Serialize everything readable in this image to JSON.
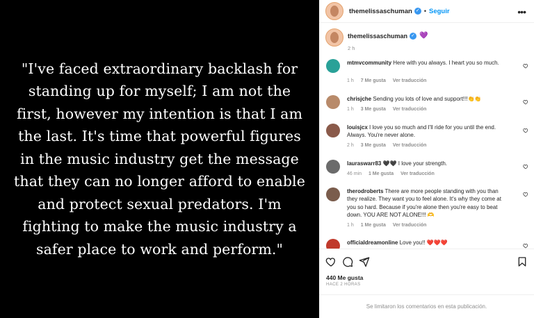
{
  "post": {
    "quote": "\"I've faced extraordinary backlash for standing up for myself; I am not the first, however my intention is that I am the last. It's time that powerful figures in the music industry get the message that they can no longer afford to enable and protect sexual predators. I'm fighting to make the music industry a safer place to work and perform.\""
  },
  "header": {
    "username": "themelissaschuman",
    "separator": "•",
    "follow_label": "Seguir",
    "more_label": "•••"
  },
  "caption": {
    "username": "themelissaschuman",
    "emoji": "💜",
    "time": "2 h"
  },
  "comments": [
    {
      "username": "mtmvcommunity",
      "text": "Here with you always. I heart you so much.",
      "time": "1 h",
      "likes": "7 Me gusta",
      "translate": "Ver traducción",
      "avatar_color": "#2aa198"
    },
    {
      "username": "chrisjche",
      "text": "Sending you lots of love and support!!!👏👏",
      "time": "1 h",
      "likes": "3 Me gusta",
      "translate": "Ver traducción",
      "avatar_color": "#b88a6a"
    },
    {
      "username": "louisjcx",
      "text": "I love you so much and I'll ride for you until the end. Always. You're never alone.",
      "time": "2 h",
      "likes": "3 Me gusta",
      "translate": "Ver traducción",
      "avatar_color": "#8a5a4a"
    },
    {
      "username": "lauraswarr83",
      "text": "🖤🖤 I love your strength.",
      "time": "46 min",
      "likes": "1 Me gusta",
      "translate": "Ver traducción",
      "avatar_color": "#6b6b6b"
    },
    {
      "username": "therodroberts",
      "text": "There are more people standing with you than they realize. They want you to feel alone. It's why they come at you so hard. Because if you're alone then you're easy to beat down. YOU ARE NOT ALONE!!! 🫶",
      "time": "1 h",
      "likes": "1 Me gusta",
      "translate": "Ver traducción",
      "avatar_color": "#7a5c4c"
    },
    {
      "username": "officialdreamonline",
      "text": "Love you!! ❤️❤️❤️",
      "time": "",
      "likes": "",
      "translate": "",
      "avatar_color": "#c0392b"
    }
  ],
  "actions": {
    "likes": "440 Me gusta",
    "ago": "HACE 2 HORAS"
  },
  "footer": {
    "notice": "Se limitaron los comentarios en esta publicación."
  }
}
